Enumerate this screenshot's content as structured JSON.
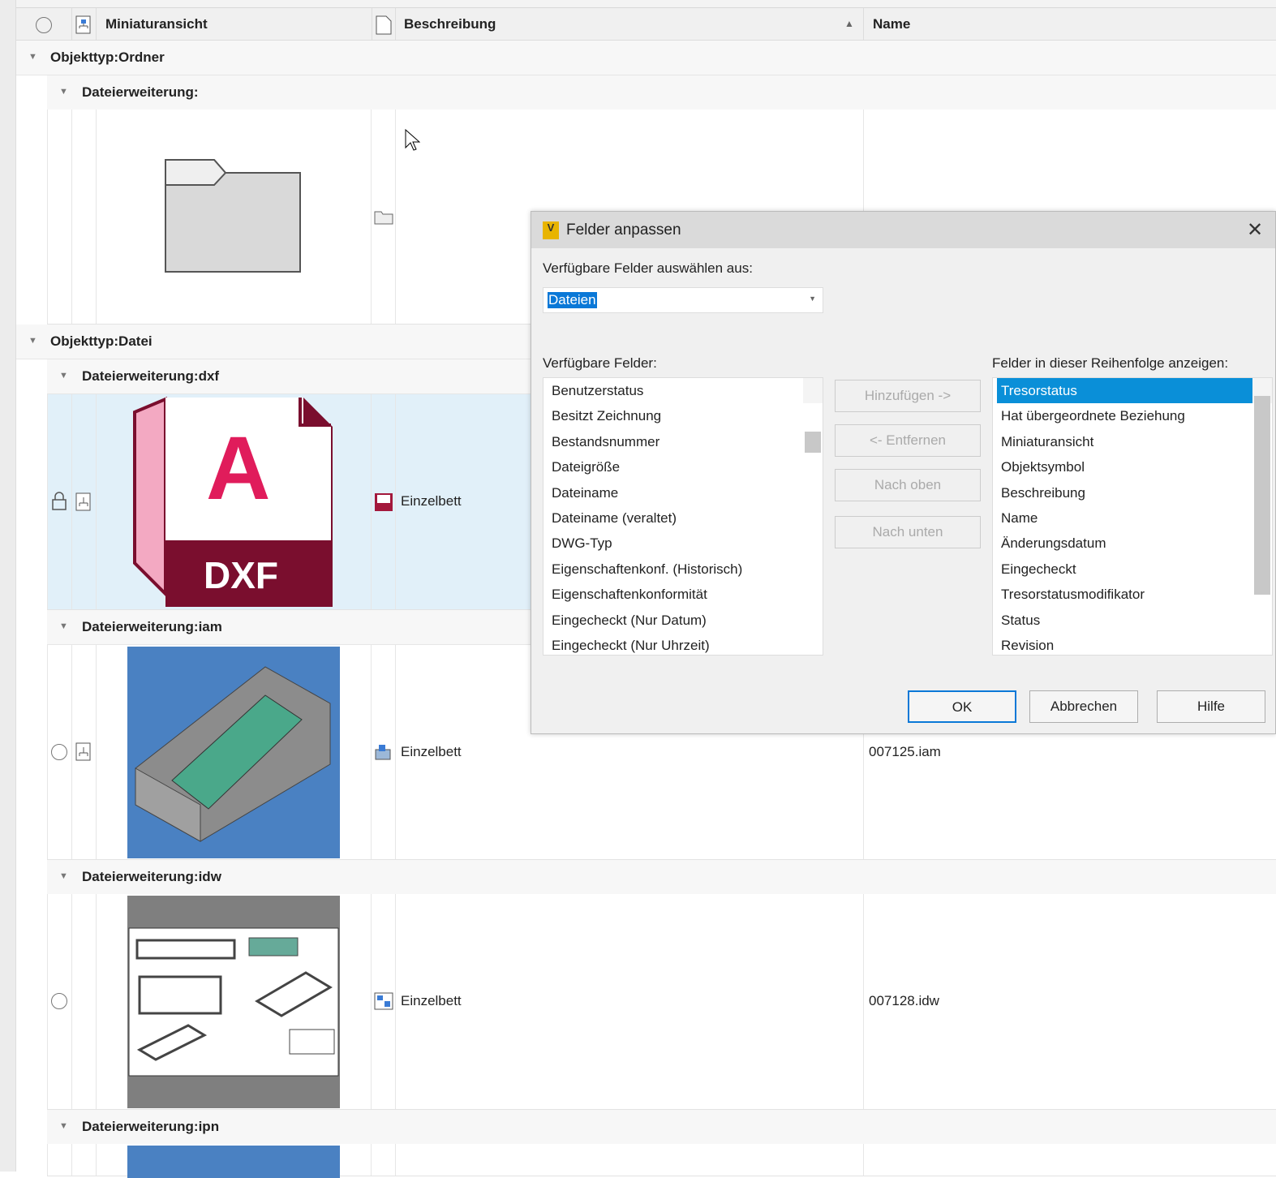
{
  "header": {
    "col_thumbnail": "Miniaturansicht",
    "col_description": "Beschreibung",
    "col_name": "Name"
  },
  "groups": {
    "ordner": "Objekttyp:Ordner",
    "ordner_ext": "Dateierweiterung:",
    "datei": "Objekttyp:Datei",
    "dxf": "Dateierweiterung:dxf",
    "iam": "Dateierweiterung:iam",
    "idw": "Dateierweiterung:idw",
    "ipn": "Dateierweiterung:ipn"
  },
  "rows": [
    {
      "description": "Einzelbett",
      "name": "",
      "thumb_label": "DXF",
      "thumb_letter": "A"
    },
    {
      "description": "Einzelbett",
      "name": "007125.iam"
    },
    {
      "description": "Einzelbett",
      "name": "007128.idw"
    }
  ],
  "dialog": {
    "title": "Felder anpassen",
    "select_label": "Verfügbare Felder auswählen aus:",
    "select_value": "Dateien",
    "available_label": "Verfügbare Felder:",
    "shown_label": "Felder in dieser Reihenfolge anzeigen:",
    "available": [
      "Benutzerstatus",
      "Besitzt Zeichnung",
      "Bestandsnummer",
      "Dateigröße",
      "Dateiname",
      "Dateiname (veraltet)",
      "DWG-Typ",
      "Eigenschaftenkonf. (Historisch)",
      "Eigenschaftenkonformität",
      "Eingecheckt (Nur Datum)",
      "Eingecheckt (Nur Uhrzeit)"
    ],
    "shown": [
      "Tresorstatus",
      "Hat übergeordnete Beziehung",
      "Miniaturansicht",
      "Objektsymbol",
      "Beschreibung",
      "Name",
      "Änderungsdatum",
      "Eingecheckt",
      "Tresorstatusmodifikator",
      "Status",
      "Revision"
    ],
    "buttons": {
      "add": "Hinzufügen ->",
      "remove": "<- Entfernen",
      "up": "Nach oben",
      "down": "Nach unten",
      "ok": "OK",
      "cancel": "Abbrechen",
      "help": "Hilfe"
    },
    "app_icon_letter": "V",
    "accent": "#0a8fd8"
  }
}
